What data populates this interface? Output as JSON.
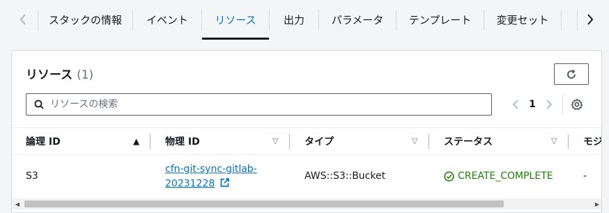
{
  "tabs": {
    "items": [
      {
        "label": "スタックの情報",
        "active": false
      },
      {
        "label": "イベント",
        "active": false
      },
      {
        "label": "リソース",
        "active": true
      },
      {
        "label": "出力",
        "active": false
      },
      {
        "label": "パラメータ",
        "active": false
      },
      {
        "label": "テンプレート",
        "active": false
      },
      {
        "label": "変更セット",
        "active": false
      }
    ],
    "prev_icon": "chevron-left-icon",
    "next_icon": "chevron-right-icon"
  },
  "panel": {
    "title": "リソース",
    "count": "(1)",
    "refresh_icon": "refresh-icon"
  },
  "search": {
    "placeholder": "リソースの検索",
    "value": ""
  },
  "pagination": {
    "current_page": "1",
    "settings_icon": "gear-icon"
  },
  "table": {
    "columns": [
      {
        "label": "論理 ID",
        "sort": "ascending"
      },
      {
        "label": "物理 ID",
        "sort": "none"
      },
      {
        "label": "タイプ",
        "sort": "none"
      },
      {
        "label": "ステータス",
        "sort": "none"
      },
      {
        "label": "モジ",
        "sort": "none"
      }
    ],
    "rows": [
      {
        "logical_id": "S3",
        "physical_id_line1": "cfn-git-sync-gitlab-",
        "physical_id_line2": "20231228",
        "type": "AWS::S3::Bucket",
        "status": "CREATE_COMPLETE",
        "module": "-"
      }
    ]
  },
  "colors": {
    "accent": "#0073bb",
    "success": "#1d8102",
    "text": "#16191f",
    "muted": "#687078"
  }
}
